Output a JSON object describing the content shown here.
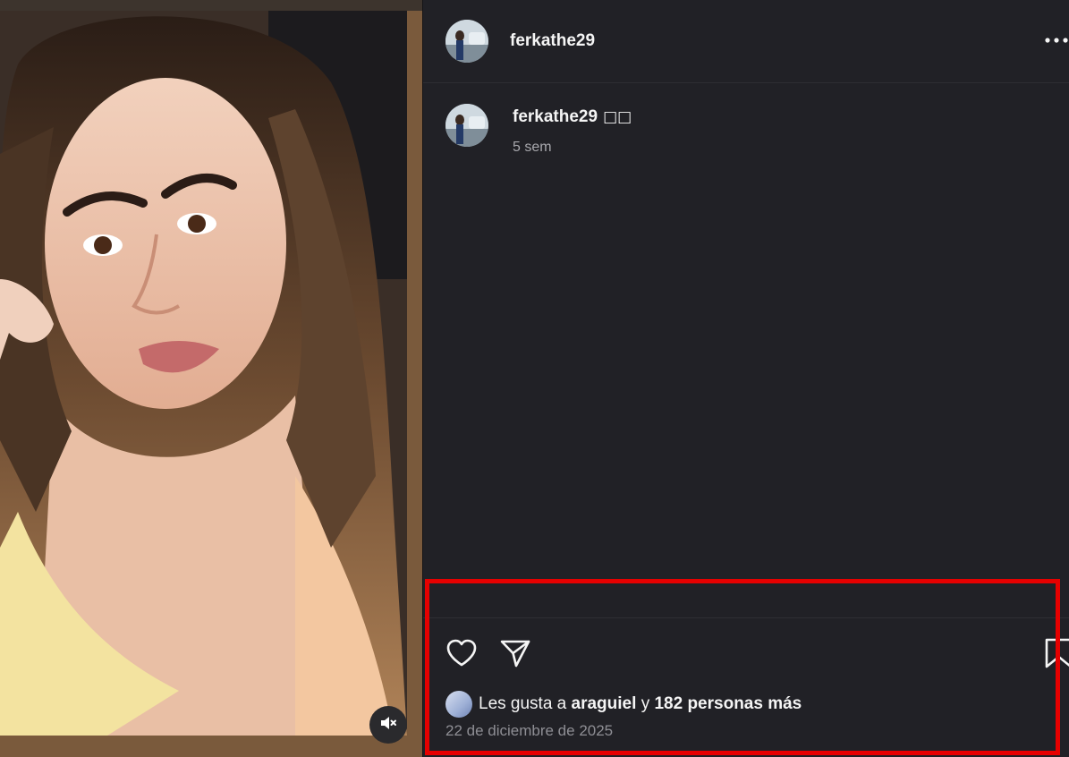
{
  "post": {
    "username": "ferkathe29",
    "more_icon": "more-horizontal-icon",
    "caption": {
      "username": "ferkathe29",
      "emoji": "□□",
      "time": "5 sem"
    },
    "actions": {
      "like_icon": "heart-icon",
      "share_icon": "send-icon",
      "save_icon": "bookmark-icon"
    },
    "likes": {
      "prefix": "Les gusta a",
      "liker": "araguiel",
      "connector": "y",
      "others": "182 personas más"
    },
    "date": "22 de diciembre de 2025"
  },
  "media": {
    "mute_icon": "speaker-muted-icon"
  },
  "colors": {
    "panel_bg": "#212126",
    "text": "#f5f5f5",
    "muted_text": "#a8a8ad",
    "highlight": "#e60000"
  }
}
